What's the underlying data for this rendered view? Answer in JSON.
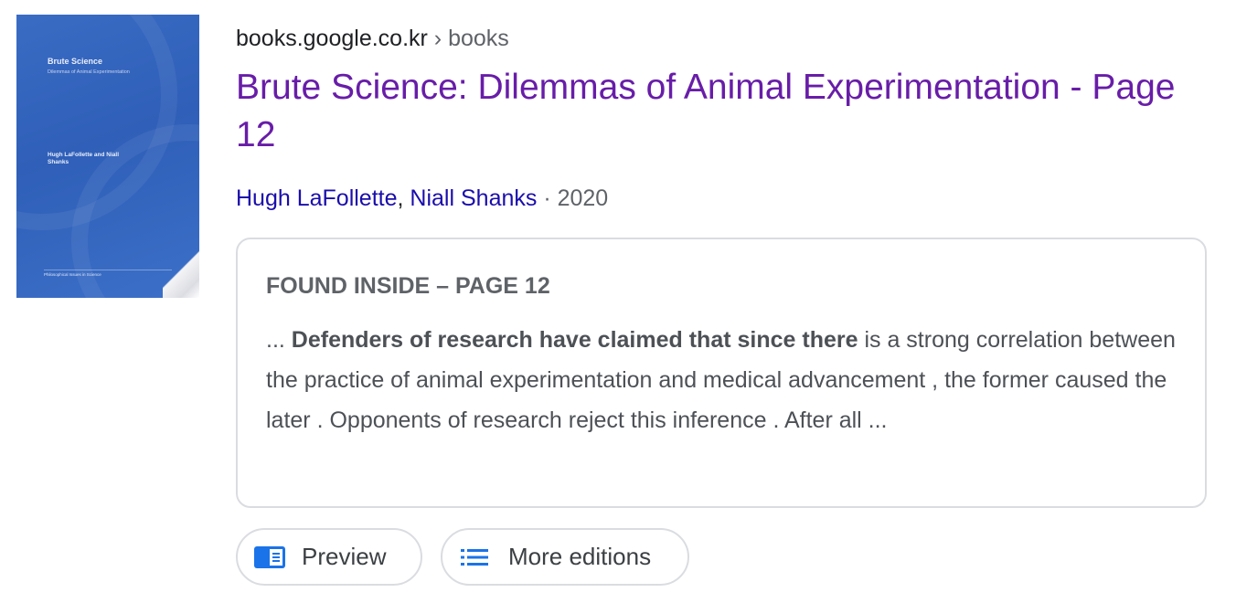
{
  "cover": {
    "title": "Brute Science",
    "subtitle": "Dilemmas of Animal Experimentation",
    "authors": "Hugh LaFollette and Niall Shanks",
    "series": "Philosophical Issues in Science"
  },
  "result": {
    "cite_domain": "books.google.co.kr",
    "cite_separator": " › ",
    "cite_path": "books",
    "title": "Brute Science: Dilemmas of Animal Experimentation - Page 12",
    "authors": [
      "Hugh LaFollette",
      "Niall Shanks"
    ],
    "author_separator": ", ",
    "year_separator": " · ",
    "year": "2020"
  },
  "snippet": {
    "heading": "FOUND INSIDE – PAGE 12",
    "prefix": "... ",
    "bold": "Defenders of research have claimed that since there",
    "rest": " is a strong correlation between the practice of animal experimentation and medical advancement , the former caused the later . Opponents of research reject this inference . After all ..."
  },
  "buttons": {
    "preview_label": "Preview",
    "preview_icon": "book-preview-icon",
    "editions_label": "More editions",
    "editions_icon": "list-icon"
  },
  "colors": {
    "title_visited": "#681da8",
    "link": "#1a0dab",
    "icon_blue": "#1a73e8",
    "border": "#dadce0"
  }
}
